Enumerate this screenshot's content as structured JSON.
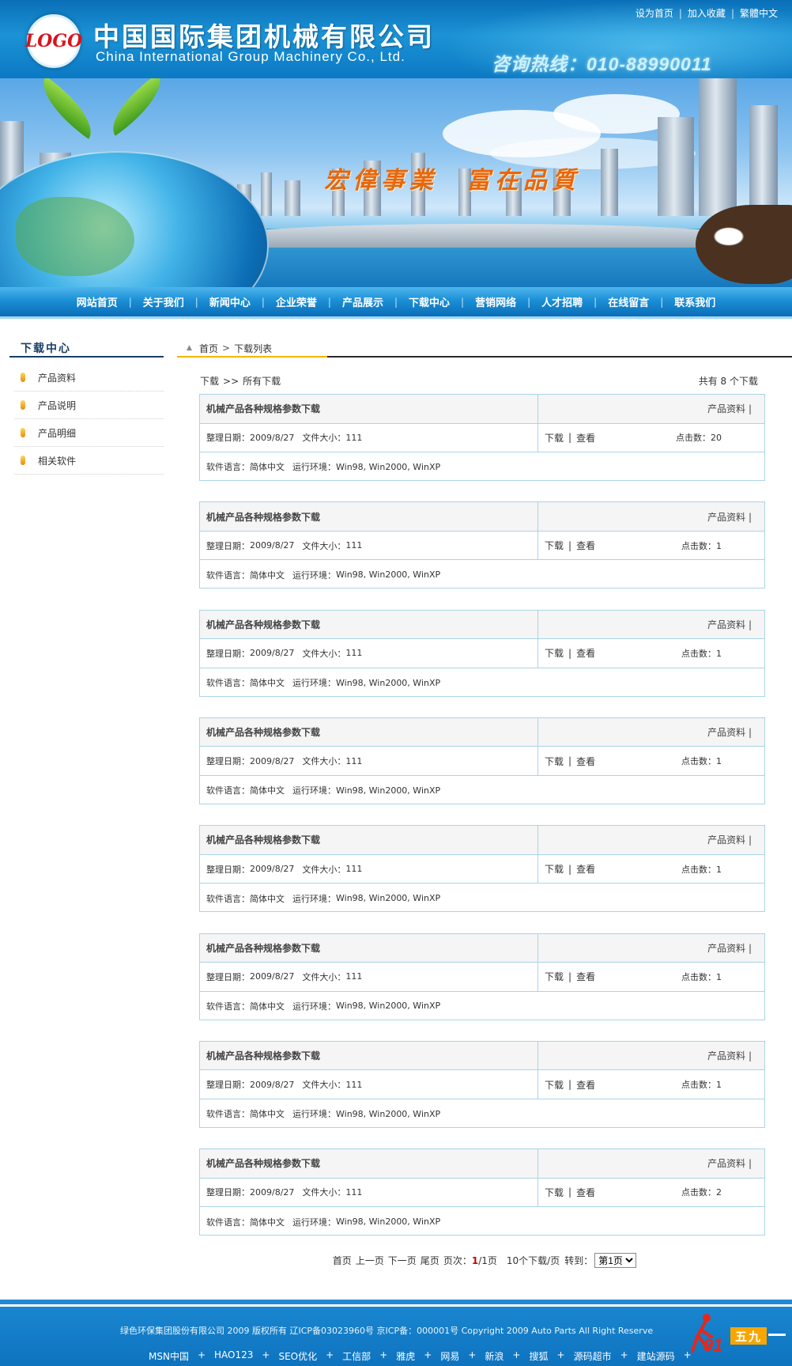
{
  "header": {
    "logo_text": "LOGO",
    "company_cn": "中国国际集团机械有限公司",
    "company_en": "China International Group Machinery Co., Ltd.",
    "hotline": "咨询热线：010-88990011",
    "top_links": [
      "设为首页",
      "加入收藏",
      "繁體中文"
    ]
  },
  "banner": {
    "slogan": "宏偉事業　富在品質"
  },
  "nav": {
    "items": [
      "网站首页",
      "关于我们",
      "新闻中心",
      "企业荣誉",
      "产品展示",
      "下载中心",
      "营销网络",
      "人才招聘",
      "在线留言",
      "联系我们"
    ],
    "separator": "|"
  },
  "sidebar": {
    "title": "下载中心",
    "items": [
      "产品资料",
      "产品说明",
      "产品明细",
      "相关软件"
    ]
  },
  "breadcrumb": {
    "home": "首页",
    "arrow": ">",
    "current": "下载列表"
  },
  "list_header": {
    "left1": "下载",
    "left2": ">>",
    "left3": "所有下载",
    "right": "共有 8 个下载"
  },
  "downloads": [
    {
      "title": "机械产品各种规格参数下载",
      "category": "产品资料 |",
      "date_label": "整理日期：",
      "date": "2009/8/27",
      "size_label": "文件大小：",
      "size": "111",
      "download": "下载",
      "sep": "|",
      "view": "查看",
      "clicks_label": "点击数：",
      "clicks": "20",
      "lang_label": "软件语言：",
      "lang": "简体中文",
      "env_label": "运行环境：",
      "env": "Win98, Win2000, WinXP"
    },
    {
      "title": "机械产品各种规格参数下载",
      "category": "产品资料 |",
      "date_label": "整理日期：",
      "date": "2009/8/27",
      "size_label": "文件大小：",
      "size": "111",
      "download": "下载",
      "sep": "|",
      "view": "查看",
      "clicks_label": "点击数：",
      "clicks": "1",
      "lang_label": "软件语言：",
      "lang": "简体中文",
      "env_label": "运行环境：",
      "env": "Win98, Win2000, WinXP"
    },
    {
      "title": "机械产品各种规格参数下载",
      "category": "产品资料 |",
      "date_label": "整理日期：",
      "date": "2009/8/27",
      "size_label": "文件大小：",
      "size": "111",
      "download": "下载",
      "sep": "|",
      "view": "查看",
      "clicks_label": "点击数：",
      "clicks": "1",
      "lang_label": "软件语言：",
      "lang": "简体中文",
      "env_label": "运行环境：",
      "env": "Win98, Win2000, WinXP"
    },
    {
      "title": "机械产品各种规格参数下载",
      "category": "产品资料 |",
      "date_label": "整理日期：",
      "date": "2009/8/27",
      "size_label": "文件大小：",
      "size": "111",
      "download": "下载",
      "sep": "|",
      "view": "查看",
      "clicks_label": "点击数：",
      "clicks": "1",
      "lang_label": "软件语言：",
      "lang": "简体中文",
      "env_label": "运行环境：",
      "env": "Win98, Win2000, WinXP"
    },
    {
      "title": "机械产品各种规格参数下载",
      "category": "产品资料 |",
      "date_label": "整理日期：",
      "date": "2009/8/27",
      "size_label": "文件大小：",
      "size": "111",
      "download": "下载",
      "sep": "|",
      "view": "查看",
      "clicks_label": "点击数：",
      "clicks": "1",
      "lang_label": "软件语言：",
      "lang": "简体中文",
      "env_label": "运行环境：",
      "env": "Win98, Win2000, WinXP"
    },
    {
      "title": "机械产品各种规格参数下载",
      "category": "产品资料 |",
      "date_label": "整理日期：",
      "date": "2009/8/27",
      "size_label": "文件大小：",
      "size": "111",
      "download": "下载",
      "sep": "|",
      "view": "查看",
      "clicks_label": "点击数：",
      "clicks": "1",
      "lang_label": "软件语言：",
      "lang": "简体中文",
      "env_label": "运行环境：",
      "env": "Win98, Win2000, WinXP"
    },
    {
      "title": "机械产品各种规格参数下载",
      "category": "产品资料 |",
      "date_label": "整理日期：",
      "date": "2009/8/27",
      "size_label": "文件大小：",
      "size": "111",
      "download": "下载",
      "sep": "|",
      "view": "查看",
      "clicks_label": "点击数：",
      "clicks": "1",
      "lang_label": "软件语言：",
      "lang": "简体中文",
      "env_label": "运行环境：",
      "env": "Win98, Win2000, WinXP"
    },
    {
      "title": "机械产品各种规格参数下载",
      "category": "产品资料 |",
      "date_label": "整理日期：",
      "date": "2009/8/27",
      "size_label": "文件大小：",
      "size": "111",
      "download": "下载",
      "sep": "|",
      "view": "查看",
      "clicks_label": "点击数：",
      "clicks": "2",
      "lang_label": "软件语言：",
      "lang": "简体中文",
      "env_label": "运行环境：",
      "env": "Win98, Win2000, WinXP"
    }
  ],
  "pager": {
    "first": "首页",
    "prev": "上一页",
    "next": "下一页",
    "last": "尾页",
    "page_label": "页次：",
    "current": "1",
    "total": "/1页",
    "per_page": "10个下载/页",
    "goto": "转到：",
    "select_value": "第1页"
  },
  "footer": {
    "copyright": "绿色环保集团股份有限公司 2009 版权所有 辽ICP备03023960号 京ICP备：000001号 Copyright 2009 Auto Parts All Right Reserve",
    "links": [
      "MSN中国",
      "HAO123",
      "SEO优化",
      "工信部",
      "雅虎",
      "网易",
      "新浪",
      "搜狐",
      "源码超市",
      "建站源码"
    ],
    "link_sep": "+",
    "watermark_num": "91",
    "watermark_box": "五九"
  },
  "colors": {
    "header_blue": "#0a6fb8",
    "nav_blue": "#1b8fd6",
    "card_border": "#a9d4e8",
    "slogan_orange": "#e8660c",
    "footer_blue": "#0e73bf",
    "pager_current": "#cc0000"
  }
}
